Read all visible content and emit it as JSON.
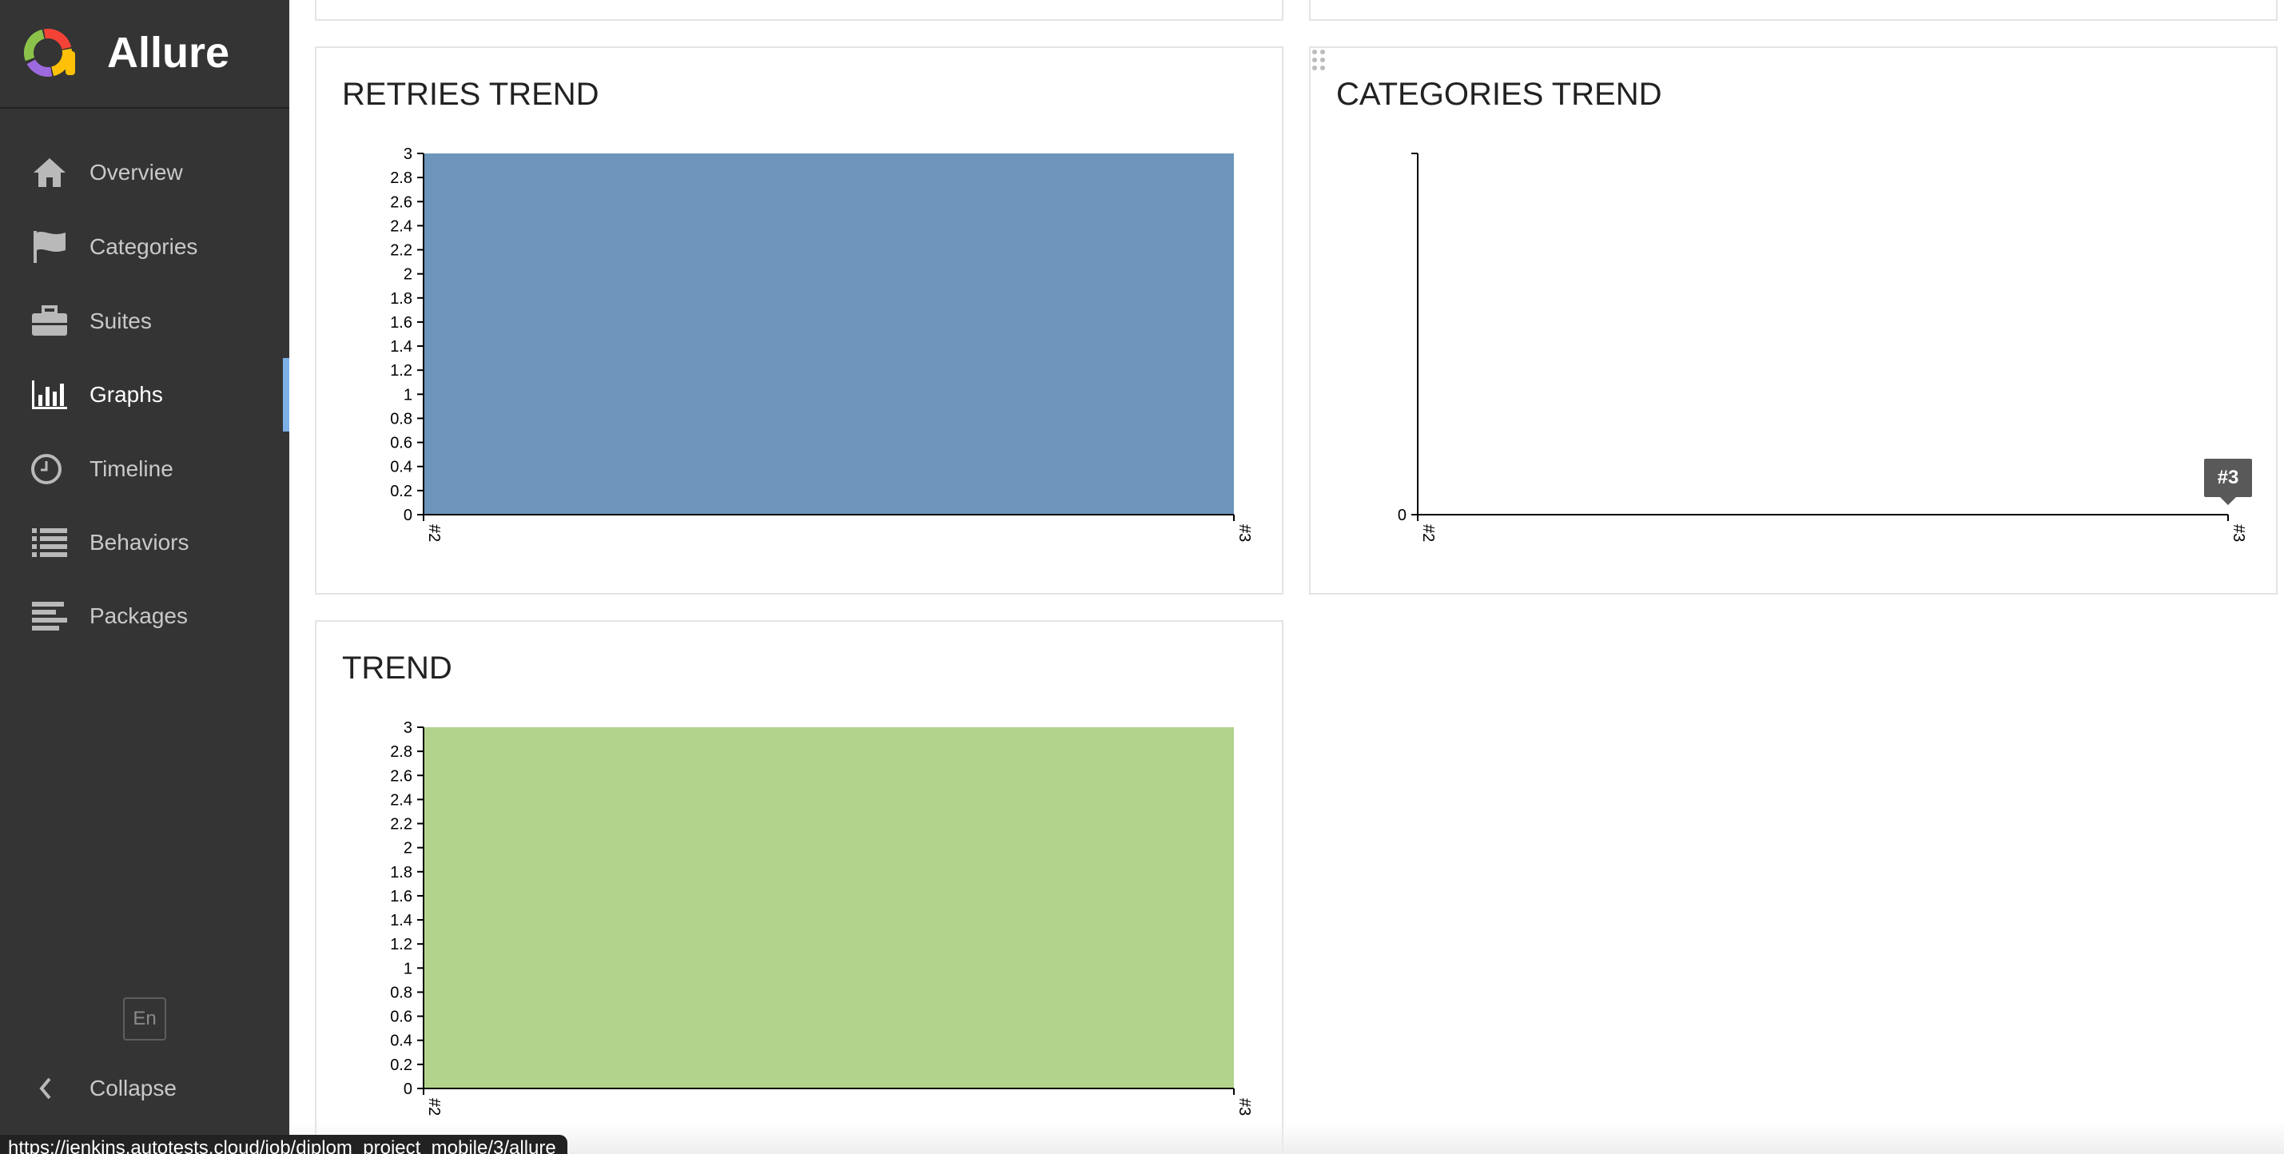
{
  "app": {
    "title": "Allure"
  },
  "sidebar": {
    "items": [
      {
        "label": "Overview",
        "icon": "home-icon",
        "active": false
      },
      {
        "label": "Categories",
        "icon": "flag-icon",
        "active": false
      },
      {
        "label": "Suites",
        "icon": "briefcase-icon",
        "active": false
      },
      {
        "label": "Graphs",
        "icon": "bar-chart-icon",
        "active": true
      },
      {
        "label": "Timeline",
        "icon": "clock-icon",
        "active": false
      },
      {
        "label": "Behaviors",
        "icon": "list-icon",
        "active": false
      },
      {
        "label": "Packages",
        "icon": "align-left-icon",
        "active": false
      }
    ],
    "language": "En",
    "collapse_label": "Collapse"
  },
  "colors": {
    "sidebar_bg": "#343434",
    "active_indicator": "#7cb1e8",
    "retries_fill": "#6d95bb",
    "trend_fill": "#b2d38b"
  },
  "widgets": {
    "retries_title": "RETRIES TREND",
    "categories_title": "CATEGORIES TREND",
    "trend_title": "TREND",
    "categories_tooltip": "#3"
  },
  "chart_data": [
    {
      "type": "area",
      "title": "RETRIES TREND",
      "x": [
        "#2",
        "#3"
      ],
      "series": [
        {
          "values": [
            3,
            3
          ]
        }
      ],
      "yticks": [
        "0",
        "0.2",
        "0.4",
        "0.6",
        "0.8",
        "1",
        "1.2",
        "1.4",
        "1.6",
        "1.8",
        "2",
        "2.2",
        "2.4",
        "2.6",
        "2.8",
        "3"
      ],
      "ylim": [
        0,
        3
      ],
      "color": "#6d95bb"
    },
    {
      "type": "area",
      "title": "CATEGORIES TREND",
      "x": [
        "#2",
        "#3"
      ],
      "series": [],
      "yticks": [
        "0"
      ],
      "ylim": [
        0,
        0
      ]
    },
    {
      "type": "area",
      "title": "TREND",
      "x": [
        "#2",
        "#3"
      ],
      "series": [
        {
          "values": [
            3,
            3
          ]
        }
      ],
      "yticks": [
        "0",
        "0.2",
        "0.4",
        "0.6",
        "0.8",
        "1",
        "1.2",
        "1.4",
        "1.6",
        "1.8",
        "2",
        "2.2",
        "2.4",
        "2.6",
        "2.8",
        "3"
      ],
      "ylim": [
        0,
        3
      ],
      "color": "#b2d38b"
    }
  ],
  "status_bar": {
    "url": "https://jenkins.autotests.cloud/job/diplom_project_mobile/3/allure"
  }
}
